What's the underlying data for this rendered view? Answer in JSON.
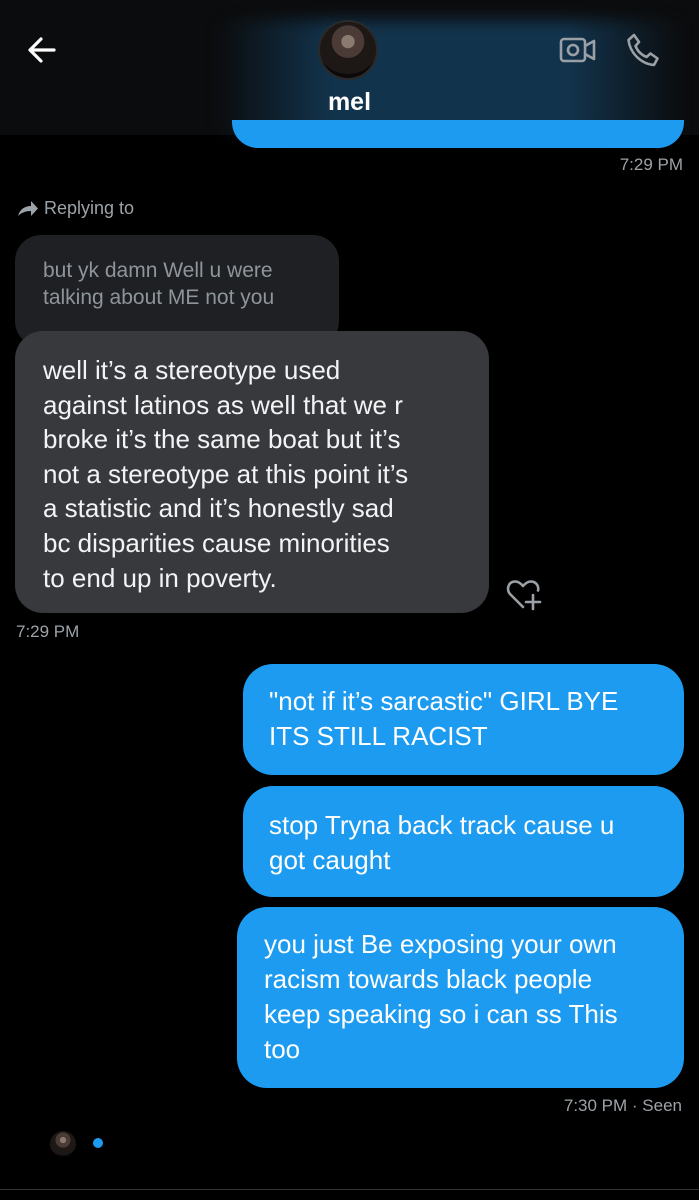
{
  "header": {
    "contact_name": "mel",
    "back_icon": "arrow-left-icon",
    "video_icon": "video-camera-icon",
    "phone_icon": "phone-icon",
    "avatar": "avatar"
  },
  "messages": {
    "prev_timestamp": "7:29 PM",
    "reply_label": "Replying to",
    "quoted_text": "but yk damn Well u were\ntalking about ME not you",
    "received_text": "well it’s a stereotype used\nagainst latinos as well that we r\nbroke it’s the same boat but it’s\nnot a stereotype at this point it’s\na statistic and it’s honestly sad\nbc disparities cause minorities\nto end up in poverty.",
    "received_timestamp": "7:29 PM",
    "sent": [
      {
        "text": "\"not if it’s sarcastic\" GIRL BYE\nITS STILL RACIST"
      },
      {
        "text": "stop Tryna back track cause u\ngot caught"
      },
      {
        "text": "you just Be exposing your own\nracism towards black people\nkeep speaking so i can ss This\ntoo"
      }
    ],
    "sent_timestamp": "7:30 PM",
    "seen_label": "· Seen"
  },
  "colors": {
    "background": "#000000",
    "sent_bubble": "#1d9bf0",
    "received_bubble": "#37393d",
    "quoted_bubble": "#1e2023",
    "meta_text": "#9ca3a8"
  }
}
